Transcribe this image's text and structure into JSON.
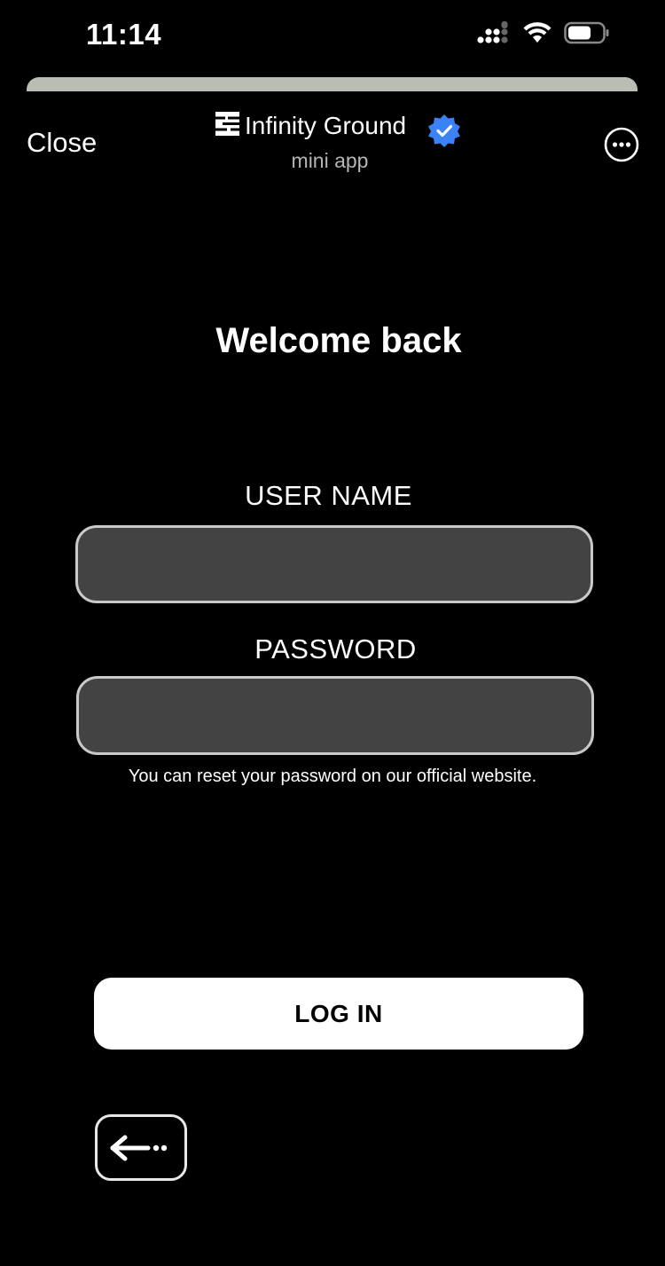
{
  "status_bar": {
    "time": "11:14"
  },
  "header": {
    "close_label": "Close",
    "app_title": "Infinity Ground",
    "app_subtitle": "mini app",
    "more_icon": "more-horizontal-icon",
    "verified_icon": "verified-badge-icon"
  },
  "login": {
    "heading": "Welcome back",
    "username_label": "USER NAME",
    "username_value": "",
    "password_label": "PASSWORD",
    "password_value": "",
    "reset_hint": "You can reset your password on our official website.",
    "login_button": "LOG IN",
    "back_icon": "back-arrow-icon"
  },
  "colors": {
    "background": "#000000",
    "input_fill": "#434343",
    "input_border": "#c9c9c9",
    "verified_blue": "#3b82f6",
    "button_fill": "#ffffff"
  }
}
